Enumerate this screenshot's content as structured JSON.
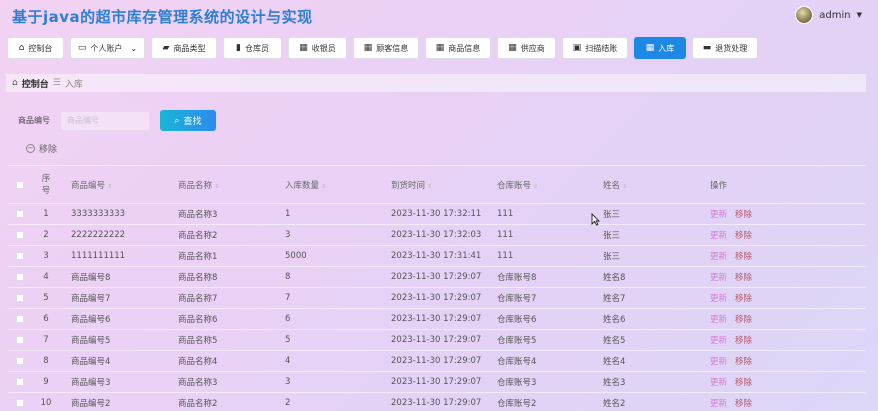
{
  "app": {
    "title": "基于java的超市库存管理系统的设计与实现"
  },
  "user": {
    "name": "admin"
  },
  "nav": [
    {
      "label": "控制台",
      "icon": "home-icon",
      "glyph": "⌂",
      "w": 57,
      "active": false
    },
    {
      "label": "个人账户",
      "icon": "wallet-icon",
      "glyph": "▭",
      "w": 75,
      "active": false,
      "dropdown": true
    },
    {
      "label": "商品类型",
      "icon": "box-icon",
      "glyph": "▰",
      "w": 66,
      "active": false
    },
    {
      "label": "仓库员",
      "icon": "chart-icon",
      "glyph": "▮",
      "w": 59,
      "active": false
    },
    {
      "label": "收银员",
      "icon": "grid-icon",
      "glyph": "▦",
      "w": 59,
      "active": false
    },
    {
      "label": "顾客信息",
      "icon": "grid-icon",
      "glyph": "▦",
      "w": 66,
      "active": false
    },
    {
      "label": "商品信息",
      "icon": "grid-icon",
      "glyph": "▦",
      "w": 66,
      "active": false
    },
    {
      "label": "供应商",
      "icon": "grid-icon",
      "glyph": "▦",
      "w": 59,
      "active": false
    },
    {
      "label": "扫描结账",
      "icon": "briefcase-icon",
      "glyph": "▣",
      "w": 66,
      "active": false
    },
    {
      "label": "入库",
      "icon": "grid-icon",
      "glyph": "▦",
      "w": 52,
      "active": true
    },
    {
      "label": "退货处理",
      "icon": "tag-icon",
      "glyph": "▬",
      "w": 66,
      "active": false
    }
  ],
  "breadcrumb": {
    "home": "控制台",
    "separator": "☰",
    "current": "入库"
  },
  "search": {
    "label": "商品编号",
    "placeholder": "商品编号",
    "button": "查找"
  },
  "actions": {
    "remove": "移除"
  },
  "table": {
    "headers": {
      "index": "序号",
      "code": "商品编号",
      "name": "商品名称",
      "qty": "入库数量",
      "time": "到货时间",
      "account": "仓库账号",
      "person": "姓名",
      "op": "操作"
    },
    "edit_label": "更新",
    "delete_label": "移除",
    "rows": [
      {
        "index": "1",
        "code": "3333333333",
        "name": "商品名称3",
        "qty": "1",
        "time": "2023-11-30 17:32:11",
        "account": "111",
        "person": "张三"
      },
      {
        "index": "2",
        "code": "2222222222",
        "name": "商品名称2",
        "qty": "3",
        "time": "2023-11-30 17:32:03",
        "account": "111",
        "person": "张三"
      },
      {
        "index": "3",
        "code": "1111111111",
        "name": "商品名称1",
        "qty": "5000",
        "time": "2023-11-30 17:31:41",
        "account": "111",
        "person": "张三"
      },
      {
        "index": "4",
        "code": "商品编号8",
        "name": "商品名称8",
        "qty": "8",
        "time": "2023-11-30 17:29:07",
        "account": "仓库账号8",
        "person": "姓名8"
      },
      {
        "index": "5",
        "code": "商品编号7",
        "name": "商品名称7",
        "qty": "7",
        "time": "2023-11-30 17:29:07",
        "account": "仓库账号7",
        "person": "姓名7"
      },
      {
        "index": "6",
        "code": "商品编号6",
        "name": "商品名称6",
        "qty": "6",
        "time": "2023-11-30 17:29:07",
        "account": "仓库账号6",
        "person": "姓名6"
      },
      {
        "index": "7",
        "code": "商品编号5",
        "name": "商品名称5",
        "qty": "5",
        "time": "2023-11-30 17:29:07",
        "account": "仓库账号5",
        "person": "姓名5"
      },
      {
        "index": "8",
        "code": "商品编号4",
        "name": "商品名称4",
        "qty": "4",
        "time": "2023-11-30 17:29:07",
        "account": "仓库账号4",
        "person": "姓名4"
      },
      {
        "index": "9",
        "code": "商品编号3",
        "name": "商品名称3",
        "qty": "3",
        "time": "2023-11-30 17:29:07",
        "account": "仓库账号3",
        "person": "姓名3"
      },
      {
        "index": "10",
        "code": "商品编号2",
        "name": "商品名称2",
        "qty": "2",
        "time": "2023-11-30 17:29:07",
        "account": "仓库账号2",
        "person": "姓名2"
      }
    ]
  }
}
